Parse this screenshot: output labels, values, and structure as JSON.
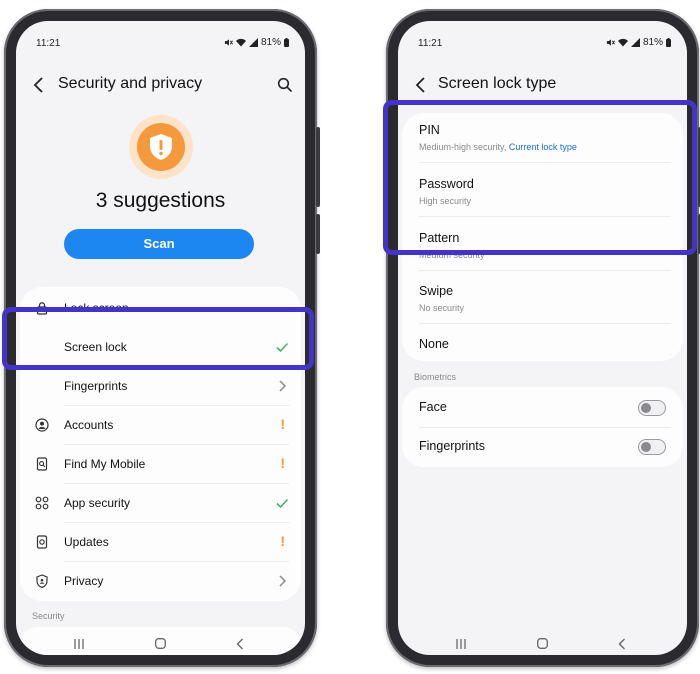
{
  "left_phone": {
    "status": {
      "time": "11:21",
      "battery": "81%"
    },
    "title": "Security and privacy",
    "suggestions": "3 suggestions",
    "scan_label": "Scan",
    "items": [
      {
        "label": "Lock screen",
        "icon": "lock-icon",
        "trailing": "none"
      },
      {
        "label": "Screen lock",
        "icon": "none",
        "trailing": "check"
      },
      {
        "label": "Fingerprints",
        "icon": "none",
        "trailing": "chevron"
      },
      {
        "label": "Accounts",
        "icon": "account-icon",
        "trailing": "warning"
      },
      {
        "label": "Find My Mobile",
        "icon": "find-mobile-icon",
        "trailing": "warning"
      },
      {
        "label": "App security",
        "icon": "app-security-icon",
        "trailing": "check"
      },
      {
        "label": "Updates",
        "icon": "updates-icon",
        "trailing": "warning"
      },
      {
        "label": "Privacy",
        "icon": "privacy-icon",
        "trailing": "chevron"
      }
    ],
    "warning_glyph": "!",
    "section_security": "Security"
  },
  "right_phone": {
    "status": {
      "time": "11:21",
      "battery": "81%"
    },
    "title": "Screen lock type",
    "options": [
      {
        "title": "PIN",
        "subtitle": "Medium-high security,",
        "subtitle_link": "Current lock type"
      },
      {
        "title": "Password",
        "subtitle": "High security"
      },
      {
        "title": "Pattern",
        "subtitle": "Medium security"
      },
      {
        "title": "Swipe",
        "subtitle": "No security"
      },
      {
        "title": "None"
      }
    ],
    "biometrics_header": "Biometrics",
    "biometrics": [
      {
        "label": "Face",
        "enabled": false
      },
      {
        "label": "Fingerprints",
        "enabled": false
      }
    ]
  },
  "colors": {
    "highlight": "#4433c8",
    "accent_blue": "#1c87f0",
    "warning_orange": "#f39a2c",
    "check_green": "#4caf68",
    "shield_orange": "#f59a3c"
  }
}
